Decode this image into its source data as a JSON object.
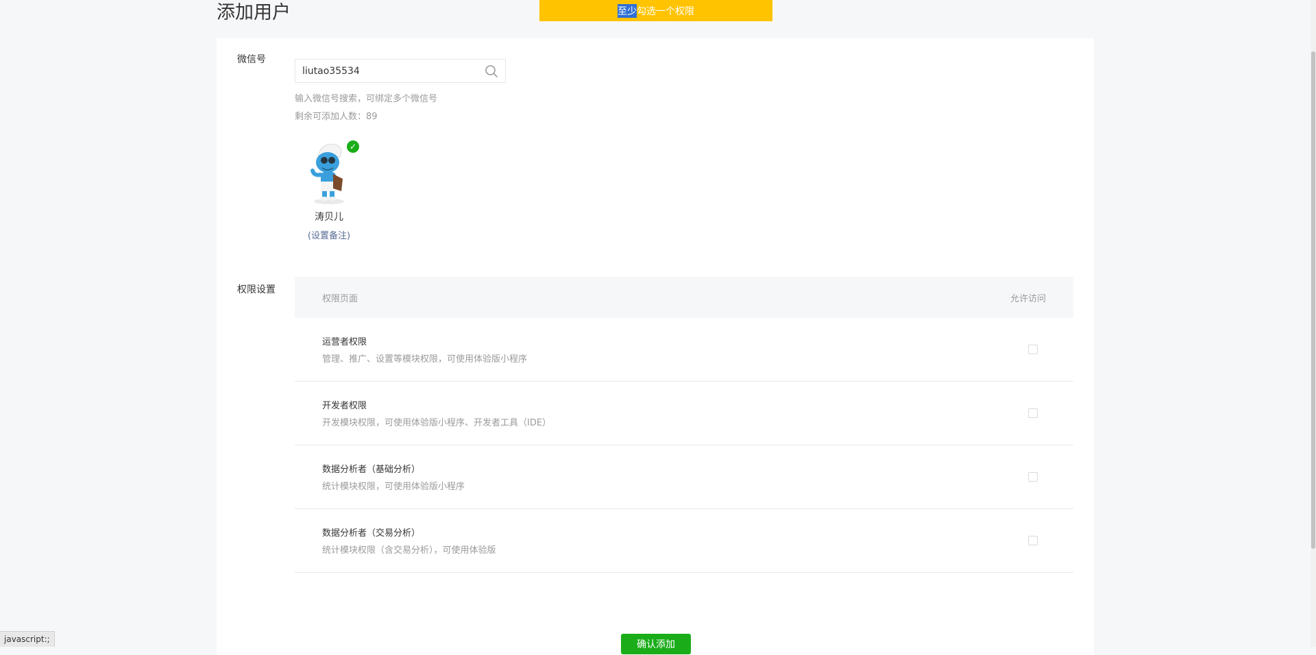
{
  "page": {
    "title": "添加用户"
  },
  "toast": {
    "highlighted": "至少",
    "rest": "勾选一个权限"
  },
  "form": {
    "wechat_label": "微信号",
    "search_value": "liutao35534",
    "hint": "输入微信号搜索，可绑定多个微信号",
    "remaining": "剩余可添加人数：89",
    "user": {
      "nickname": "涛贝儿",
      "remark_link": "(设置备注)"
    }
  },
  "permissions": {
    "label": "权限设置",
    "header_page": "权限页面",
    "header_access": "允许访问",
    "rows": [
      {
        "title": "运营者权限",
        "desc": "管理、推广、设置等模块权限，可使用体验版小程序"
      },
      {
        "title": "开发者权限",
        "desc": "开发模块权限，可使用体验版小程序、开发者工具（IDE）"
      },
      {
        "title": "数据分析者（基础分析）",
        "desc": "统计模块权限，可使用体验版小程序"
      },
      {
        "title": "数据分析者（交易分析）",
        "desc": "统计模块权限（含交易分析），可使用体验版"
      }
    ]
  },
  "confirm_button": "确认添加",
  "status_bar": "javascript:;",
  "colors": {
    "toast": "#ffc300",
    "primary_green": "#1aad19",
    "link": "#576b95"
  }
}
